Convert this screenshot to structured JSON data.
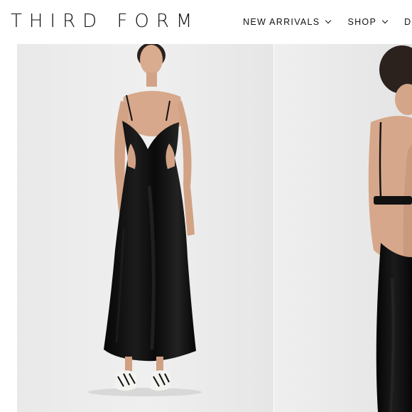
{
  "brand": {
    "logo_text": "THIRD FORM"
  },
  "nav": {
    "items": [
      {
        "label": "NEW ARRIVALS",
        "has_dropdown": true,
        "icon": "chevron-down-icon"
      },
      {
        "label": "SHOP",
        "has_dropdown": true,
        "icon": "chevron-down-icon"
      },
      {
        "label": "DRES",
        "has_dropdown": false
      }
    ]
  },
  "gallery": {
    "images": [
      {
        "subject": "model in black satin slip dress, front view"
      },
      {
        "subject": "model in black satin slip dress, back view"
      }
    ]
  },
  "colors": {
    "background": "#ffffff",
    "photo_backdrop": "#ececec",
    "dress": "#0d0d0d",
    "text": "#111111"
  }
}
